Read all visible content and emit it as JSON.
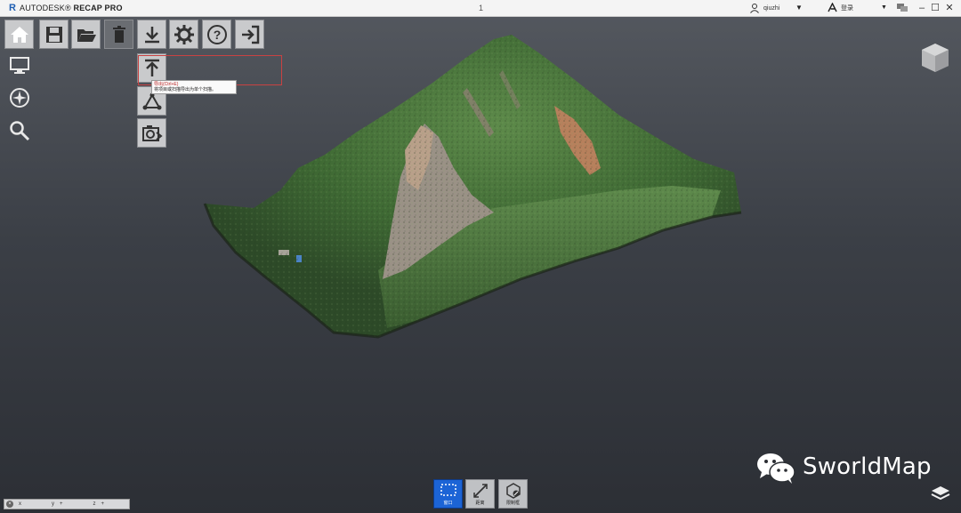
{
  "titlebar": {
    "brand": "AUTODESK",
    "product": "RECAP PRO",
    "center_text": "1",
    "user_label": "qiuzhi",
    "a360_label": "登录",
    "window_buttons": [
      "–",
      "☐",
      "✕"
    ]
  },
  "toolbar": {
    "items": [
      {
        "name": "home",
        "icon": "home-icon"
      },
      {
        "name": "save",
        "icon": "save-icon"
      },
      {
        "name": "open",
        "icon": "folder-open-icon"
      },
      {
        "name": "delete",
        "icon": "trash-icon"
      },
      {
        "name": "export",
        "icon": "download-icon"
      },
      {
        "name": "settings",
        "icon": "gear-icon"
      },
      {
        "name": "help",
        "icon": "help-icon"
      },
      {
        "name": "exit",
        "icon": "exit-icon"
      }
    ],
    "dropdown": [
      {
        "name": "export-top",
        "icon": "upload-arrow-icon"
      },
      {
        "name": "share",
        "icon": "share-nodes-icon"
      },
      {
        "name": "screenshot",
        "icon": "camera-icon"
      }
    ],
    "tooltip": {
      "title": "导出(Ctrl+E)",
      "desc": "将项目或扫描导出为单个扫描。"
    }
  },
  "left_nav": [
    "display-icon",
    "navigate-wheel-icon",
    "search-icon"
  ],
  "bottom_tools": [
    {
      "name": "window-select",
      "label": "窗口",
      "active": true
    },
    {
      "name": "measure",
      "label": "距离",
      "active": false
    },
    {
      "name": "limit-box",
      "label": "限制框",
      "active": false
    }
  ],
  "statusbar": {
    "items": [
      "x",
      "y",
      "+",
      "z",
      "+"
    ]
  },
  "watermark": {
    "text": "SworldMap"
  },
  "colors": {
    "accent_blue": "#1c64d6",
    "highlight_red": "#c84242",
    "vegetation_green": "#4a7a3a",
    "rock_grey": "#9a9186"
  }
}
